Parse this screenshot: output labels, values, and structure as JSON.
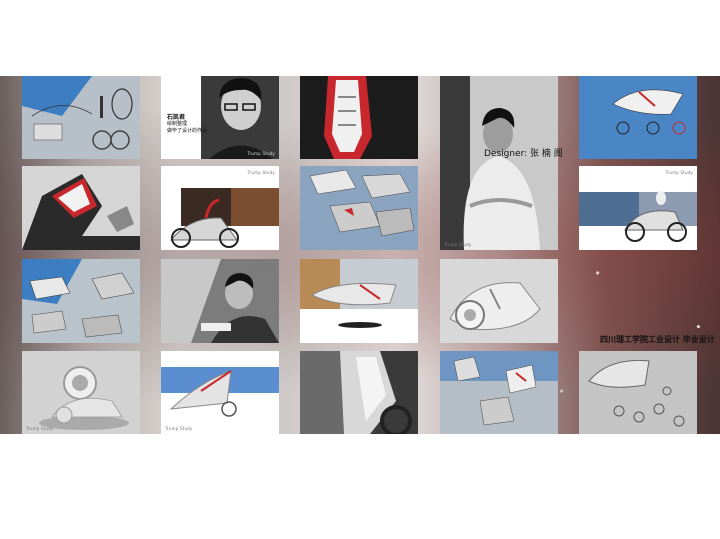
{
  "meta": {
    "background": "#ffffff",
    "accent_red": "#c8282d",
    "accent_blue": "#3f7fc1"
  },
  "profile_caption": {
    "name": "石凯君",
    "line1": "绘制整理",
    "line2": "做毕了设计的作品"
  },
  "designer_label": "Designer: 张 楠 阁",
  "school_label": "四川理工学院工业设计  毕业设计",
  "credit_text": "Trump Study",
  "tiles": [
    {
      "id": "t1"
    },
    {
      "id": "t2"
    },
    {
      "id": "t3"
    },
    {
      "id": "t4"
    },
    {
      "id": "t5"
    },
    {
      "id": "t6"
    },
    {
      "id": "t7"
    },
    {
      "id": "t8"
    },
    {
      "id": "t9"
    },
    {
      "id": "t10"
    },
    {
      "id": "t11"
    },
    {
      "id": "t12"
    },
    {
      "id": "t13"
    },
    {
      "id": "t14"
    },
    {
      "id": "t15"
    },
    {
      "id": "t16"
    },
    {
      "id": "t17"
    },
    {
      "id": "t18"
    }
  ]
}
